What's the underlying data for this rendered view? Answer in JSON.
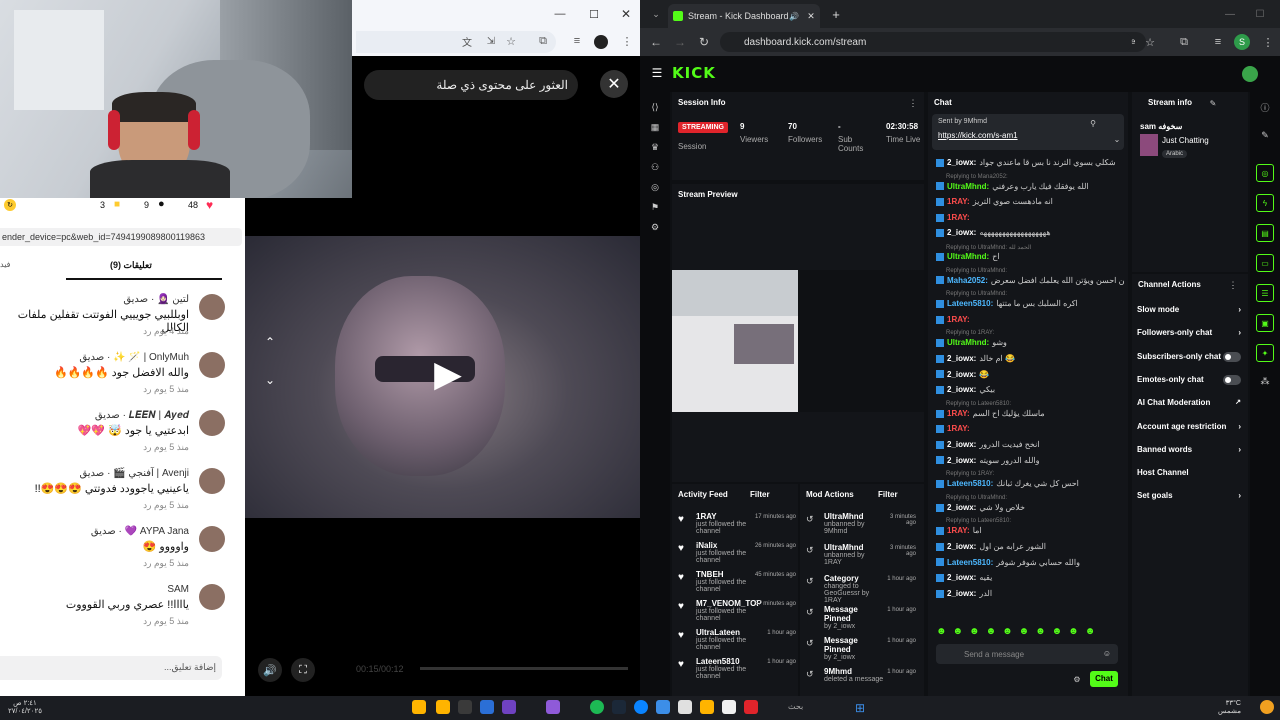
{
  "left_browser": {
    "url_fragment": "ender_device=pc&web_id=7494199089800119863",
    "search_text": "العثور على محتوى ذي صلة",
    "stats": {
      "likes": "48",
      "comments": "9",
      "saves": "3"
    },
    "tabs": {
      "comments_label": "تعليقات (9)",
      "other_label": "فيد"
    },
    "comments": [
      {
        "name": "لتين 🧕🏻 · صديق",
        "text": "اوبللبيي جويييي الفوتتت تقفلين ملفات الكالل",
        "meta": "منذ 4 يوم  رد"
      },
      {
        "name": "OnlyMuh | 🪄 ✨ · صديق",
        "text": "والله الافضل جود 🔥🔥🔥🔥",
        "meta": "منذ 5 يوم  رد"
      },
      {
        "name": "𝑳𝑬𝑬𝑵 | 𝑨𝒚𝒆𝒅 · صديق",
        "text": "ابدعتيي يا جود 🤯 💖💖",
        "meta": "منذ 5 يوم  رد"
      },
      {
        "name": "Avenji | آفنجي 🎬 · صديق",
        "text": "ياعينيي ياجوودد فدوتتي 😍😍😍!!",
        "meta": "منذ 5 يوم  رد"
      },
      {
        "name": "AYPA Jana 💜 · صديق",
        "text": "واوووو 😍",
        "meta": "منذ 5 يوم  رد"
      },
      {
        "name": "SAM",
        "text": "ياااا!! عصري وربي القوووت",
        "meta": "منذ 5 يوم  رد"
      }
    ],
    "comment_placeholder": "إضافة تعليق...",
    "video_time": "00:15/00:12"
  },
  "right_browser": {
    "tab_title": "Stream - Kick Dashboard",
    "url": "dashboard.kick.com/stream",
    "ask_google": "Ask Google",
    "kick_logo": "KICK",
    "session": {
      "title": "Session Info",
      "status": "STREAMING",
      "session_label": "Session",
      "viewers_val": "9",
      "viewers_label": "Viewers",
      "followers_val": "70",
      "followers_label": "Followers",
      "subs_val": "-",
      "subs_label": "Sub Counts",
      "time_val": "02:30:58",
      "time_label": "Time Live"
    },
    "preview_title": "Stream Preview",
    "activity": {
      "title": "Activity Feed",
      "filter": "Filter",
      "items": [
        {
          "name": "1RAY",
          "desc": "just followed the channel",
          "time": "17 minutes ago"
        },
        {
          "name": "iNalix",
          "desc": "just followed the channel",
          "time": "26 minutes ago"
        },
        {
          "name": "TNBEH",
          "desc": "just followed the channel",
          "time": "45 minutes ago"
        },
        {
          "name": "M7_VENOM_TOP",
          "desc": "just followed the channel",
          "time": "57 minutes ago"
        },
        {
          "name": "UltraLateen",
          "desc": "just followed the channel",
          "time": "1 hour ago"
        },
        {
          "name": "Lateen5810",
          "desc": "just followed the channel",
          "time": "1 hour ago"
        }
      ]
    },
    "mod": {
      "title": "Mod Actions",
      "filter": "Filter",
      "items": [
        {
          "name": "UltraMhnd",
          "desc": "unbanned by 9Mhmd",
          "time": "3 minutes ago"
        },
        {
          "name": "UltraMhnd",
          "desc": "unbanned by 1RAY",
          "time": "3 minutes ago"
        },
        {
          "name": "Category",
          "desc": "changed to GeoGuessr by 1RAY",
          "time": "1 hour ago"
        },
        {
          "name": "Message Pinned",
          "desc": "by 2_iowx",
          "time": "1 hour ago"
        },
        {
          "name": "Message Pinned",
          "desc": "by 2_iowx",
          "time": "1 hour ago"
        },
        {
          "name": "9Mhmd",
          "desc": "deleted a message",
          "time": "1 hour ago"
        }
      ]
    },
    "chat": {
      "title": "Chat",
      "pinned_by": "Sent by 9Mhmd",
      "pinned_link": "https://kick.com/s-am1",
      "lines": [
        {
          "user": "2_iowx:",
          "text": "شكلي بسوي الترند نا بس قا ماعندي جواد",
          "color": "#ffffff"
        },
        {
          "reply": "Replying to Mana2052: "
        },
        {
          "user": "UltraMhnd:",
          "text": "الله يوفقك فيك يارب وعرفني",
          "color": "#53fc18"
        },
        {
          "user": "1RAY:",
          "text": "انه مادهست صوي التريز",
          "color": "#ff4d4d"
        },
        {
          "user": "1RAY:",
          "text": "",
          "color": "#ff4d4d"
        },
        {
          "user": "2_iowx:",
          "text": "ههههههههههههههههههه",
          "color": "#ffffff"
        },
        {
          "reply": "Replying to UltraMhnd: الحمد لله"
        },
        {
          "user": "UltraMhnd:",
          "text": "اح",
          "color": "#53fc18"
        },
        {
          "reply": "Replying to UltraMhnd: "
        },
        {
          "user": "Maha2052:",
          "text": "احسن احسن ويؤتن الله يعلمك افضل سعرض",
          "color": "#4db8ff"
        },
        {
          "reply": "Replying to UltraMhnd: "
        },
        {
          "user": "Lateen5810:",
          "text": "اكره السلبك بس ما متتها",
          "color": "#4db8ff"
        },
        {
          "user": "1RAY:",
          "text": "",
          "color": "#ff4d4d"
        },
        {
          "reply": "Replying to 1RAY: "
        },
        {
          "user": "UltraMhnd:",
          "text": "وشو",
          "color": "#53fc18"
        },
        {
          "user": "2_iowx:",
          "text": "ام خالد 😂",
          "color": "#ffffff"
        },
        {
          "user": "2_iowx:",
          "text": "😂",
          "color": "#ffffff"
        },
        {
          "user": "2_iowx:",
          "text": "بيكي",
          "color": "#ffffff"
        },
        {
          "reply": "Replying to Lateen5810: "
        },
        {
          "user": "1RAY:",
          "text": "ماسلك يؤليك اح السم",
          "color": "#ff4d4d"
        },
        {
          "user": "1RAY:",
          "text": "",
          "color": "#ff4d4d"
        },
        {
          "user": "2_iowx:",
          "text": "انخح فيديت الدرور",
          "color": "#ffffff"
        },
        {
          "user": "2_iowx:",
          "text": "والله الدرور سويته",
          "color": "#ffffff"
        },
        {
          "reply": "Replying to 1RAY: "
        },
        {
          "user": "Lateen5810:",
          "text": "احس كل شي يغرك ثبانك",
          "color": "#4db8ff"
        },
        {
          "reply": "Replying to UltraMhnd: "
        },
        {
          "user": "2_iowx:",
          "text": "خلاص ولا شي",
          "color": "#ffffff"
        },
        {
          "reply": "Replying to Lateen5810: "
        },
        {
          "user": "1RAY:",
          "text": "اما",
          "color": "#ff4d4d"
        },
        {
          "user": "2_iowx:",
          "text": "الشور عرابه من اول",
          "color": "#ffffff"
        },
        {
          "user": "Lateen5810:",
          "text": "والله حسابي شوفر شوفر",
          "color": "#4db8ff"
        },
        {
          "user": "2_iowx:",
          "text": "يقيه",
          "color": "#ffffff"
        },
        {
          "user": "2_iowx:",
          "text": "الدر",
          "color": "#ffffff"
        }
      ],
      "placeholder": "Send a message",
      "send_label": "Chat"
    },
    "stream_info": {
      "title": "Stream info",
      "streamer": "sam سخوفه",
      "category": "Just Chatting",
      "tag": "Arabic"
    },
    "channel_actions": {
      "title": "Channel Actions",
      "items": [
        {
          "label": "Slow mode",
          "kind": "arrow"
        },
        {
          "label": "Followers-only chat",
          "kind": "arrow"
        },
        {
          "label": "Subscribers-only chat",
          "kind": "toggle"
        },
        {
          "label": "Emotes-only chat",
          "kind": "toggle"
        },
        {
          "label": "AI Chat Moderation",
          "kind": "ext"
        },
        {
          "label": "Account age restriction",
          "kind": "arrow"
        },
        {
          "label": "Banned words",
          "kind": "arrow"
        },
        {
          "label": "Host Channel",
          "kind": "none"
        },
        {
          "label": "Set goals",
          "kind": "arrow"
        }
      ]
    }
  },
  "taskbar": {
    "temp": "٣٣°C",
    "weather": "مشمس",
    "time": "٢:٤١ ص",
    "date": "٢٧/٠٤/٢٠٢٥",
    "search": "بحث"
  },
  "colors": {
    "kick_green": "#53fc18",
    "streaming_red": "#e0242b",
    "dark_panel": "#131519"
  }
}
